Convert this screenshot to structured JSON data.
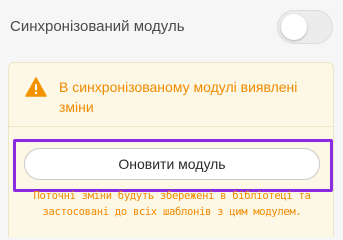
{
  "sync_module": {
    "label": "Синхронізований модуль",
    "toggle_state": "off"
  },
  "warning": {
    "icon": "warning-triangle-icon",
    "message": "В синхронізованому модулі виявлені зміни",
    "note": "Поточні зміни будуть збережені в бібліотеці та застосовані до всіх шаблонів з цим модулем."
  },
  "actions": {
    "update_label": "Оновити модуль"
  },
  "colors": {
    "warning_text": "#ef8a00",
    "warning_bg": "#fdf8e6",
    "highlight": "#8a2be2",
    "toggle_off": "#ececec"
  }
}
